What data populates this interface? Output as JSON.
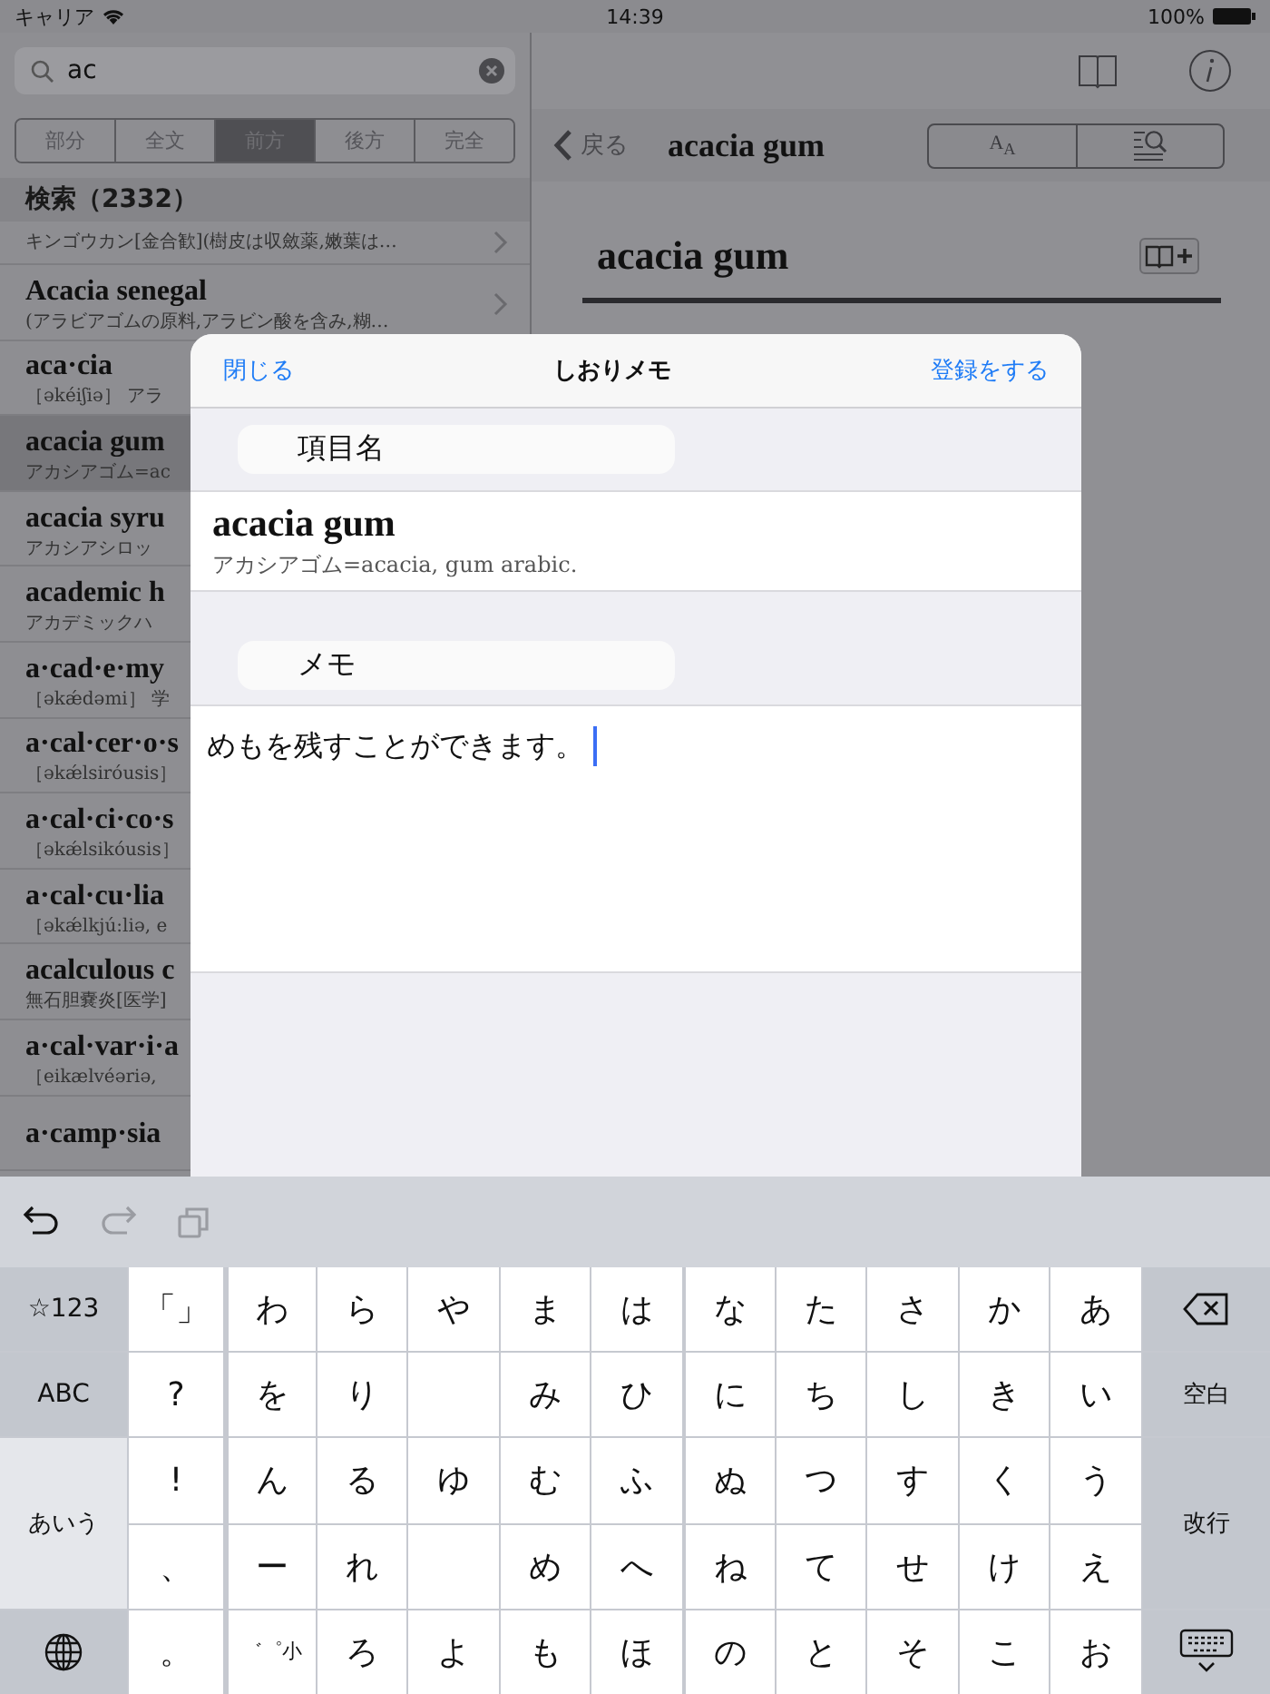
{
  "status_bar": {
    "carrier": "キャリア",
    "time": "14:39",
    "battery": "100%"
  },
  "sidebar": {
    "search": {
      "value": "ac"
    },
    "segments": [
      {
        "label": "部分",
        "selected": false
      },
      {
        "label": "全文",
        "selected": false
      },
      {
        "label": "前方",
        "selected": true
      },
      {
        "label": "後方",
        "selected": false
      },
      {
        "label": "完全",
        "selected": false
      }
    ],
    "results_header": "検索（2332）",
    "items": [
      {
        "subtitle": "キンゴウカン[金合歓](樹皮は収斂薬,嫩葉は…",
        "selected": false,
        "chevron": true
      },
      {
        "title": "Acacia senegal",
        "subtitle": "(アラビアゴムの原料,アラビン酸を含み,糊…",
        "selected": false,
        "chevron": true
      },
      {
        "title": "aca·cia",
        "subtitle": "［əkéiʃiə］ アラ",
        "selected": false,
        "chevron": false
      },
      {
        "title": "acacia gum",
        "subtitle": "アカシアゴム=ac",
        "selected": true,
        "chevron": false
      },
      {
        "title": "acacia syru",
        "subtitle": "アカシアシロッ",
        "selected": false,
        "chevron": false
      },
      {
        "title": "academic h",
        "subtitle": "アカデミックハ",
        "selected": false,
        "chevron": false
      },
      {
        "title": "a·cad·e·my",
        "subtitle": "［əkǽdəmi］ 学",
        "selected": false,
        "chevron": false
      },
      {
        "title": "a·cal·cer·o·s",
        "subtitle": "［əkǽlsiróusis］",
        "selected": false,
        "chevron": false
      },
      {
        "title": "a·cal·ci·co·s",
        "subtitle": "［əkǽlsikóusis］",
        "selected": false,
        "chevron": false
      },
      {
        "title": "a·cal·cu·lia",
        "subtitle": "［əkǽlkjú:liə, e",
        "selected": false,
        "chevron": false
      },
      {
        "title": "acalculous c",
        "subtitle": "無石胆嚢炎[医学]",
        "selected": false,
        "chevron": false
      },
      {
        "title": "a·cal·var·i·a",
        "subtitle": "［eikælvéəriə,",
        "selected": false,
        "chevron": false
      },
      {
        "title": "a·camp·sia",
        "selected": false,
        "chevron": false
      }
    ]
  },
  "detail": {
    "back": "戻る",
    "title": "acacia gum",
    "font_button": "A$_{A}$",
    "headword": "acacia gum"
  },
  "modal": {
    "close": "閉じる",
    "title": "しおりメモ",
    "save": "登録をする",
    "name_label": "項目名",
    "entry_title": "acacia gum",
    "entry_subtitle": "アカシアゴム=acacia, gum arabic.",
    "memo_label": "メモ",
    "memo_value": "めもを残すことができます。"
  },
  "keyboard": {
    "toolbar": [
      {
        "kind": "undo",
        "disabled": false
      },
      {
        "kind": "redo",
        "disabled": true
      },
      {
        "kind": "paste",
        "disabled": true
      }
    ],
    "left_keys": [
      {
        "kind": "key",
        "label": "☆123",
        "selected": false
      },
      {
        "kind": "key",
        "label": "ABC",
        "selected": false
      },
      {
        "kind": "tall",
        "label": "あいう",
        "selected": true
      },
      {
        "kind": "globe",
        "selected": false
      }
    ],
    "rows": [
      [
        {
          "kind": "char",
          "label": "「」"
        },
        {
          "kind": "char",
          "label": "わ"
        },
        {
          "kind": "char",
          "label": "ら"
        },
        {
          "kind": "char",
          "label": "や"
        },
        {
          "kind": "char",
          "label": "ま"
        },
        {
          "kind": "char",
          "label": "は"
        },
        {
          "kind": "char",
          "label": "な"
        },
        {
          "kind": "char",
          "label": "た"
        },
        {
          "kind": "char",
          "label": "さ"
        },
        {
          "kind": "char",
          "label": "か"
        },
        {
          "kind": "char",
          "label": "あ"
        }
      ],
      [
        {
          "kind": "char",
          "label": "?"
        },
        {
          "kind": "char",
          "label": "を"
        },
        {
          "kind": "char",
          "label": "り"
        },
        {
          "kind": "blank"
        },
        {
          "kind": "char",
          "label": "み"
        },
        {
          "kind": "char",
          "label": "ひ"
        },
        {
          "kind": "char",
          "label": "に"
        },
        {
          "kind": "char",
          "label": "ち"
        },
        {
          "kind": "char",
          "label": "し"
        },
        {
          "kind": "char",
          "label": "き"
        },
        {
          "kind": "char",
          "label": "い"
        }
      ],
      [
        {
          "kind": "char",
          "label": "!"
        },
        {
          "kind": "char",
          "label": "ん"
        },
        {
          "kind": "char",
          "label": "る"
        },
        {
          "kind": "char",
          "label": "ゆ"
        },
        {
          "kind": "char",
          "label": "む"
        },
        {
          "kind": "char",
          "label": "ふ"
        },
        {
          "kind": "char",
          "label": "ぬ"
        },
        {
          "kind": "char",
          "label": "つ"
        },
        {
          "kind": "char",
          "label": "す"
        },
        {
          "kind": "char",
          "label": "く"
        },
        {
          "kind": "char",
          "label": "う"
        }
      ],
      [
        {
          "kind": "char",
          "label": "、"
        },
        {
          "kind": "char",
          "label": "ー"
        },
        {
          "kind": "char",
          "label": "れ"
        },
        {
          "kind": "blank"
        },
        {
          "kind": "char",
          "label": "め"
        },
        {
          "kind": "char",
          "label": "へ"
        },
        {
          "kind": "char",
          "label": "ね"
        },
        {
          "kind": "char",
          "label": "て"
        },
        {
          "kind": "char",
          "label": "せ"
        },
        {
          "kind": "char",
          "label": "け"
        },
        {
          "kind": "char",
          "label": "え"
        }
      ],
      [
        {
          "kind": "char",
          "label": "。"
        },
        {
          "kind": "small",
          "label": "゛゜小"
        },
        {
          "kind": "char",
          "label": "ろ"
        },
        {
          "kind": "char",
          "label": "よ"
        },
        {
          "kind": "char",
          "label": "も"
        },
        {
          "kind": "char",
          "label": "ほ"
        },
        {
          "kind": "char",
          "label": "の"
        },
        {
          "kind": "char",
          "label": "と"
        },
        {
          "kind": "char",
          "label": "そ"
        },
        {
          "kind": "char",
          "label": "こ"
        },
        {
          "kind": "char",
          "label": "お"
        }
      ]
    ],
    "right_keys": [
      {
        "kind": "delete"
      },
      {
        "kind": "key",
        "label": "空白"
      },
      {
        "kind": "tall",
        "label": "改行"
      },
      {
        "kind": "hide"
      }
    ]
  }
}
